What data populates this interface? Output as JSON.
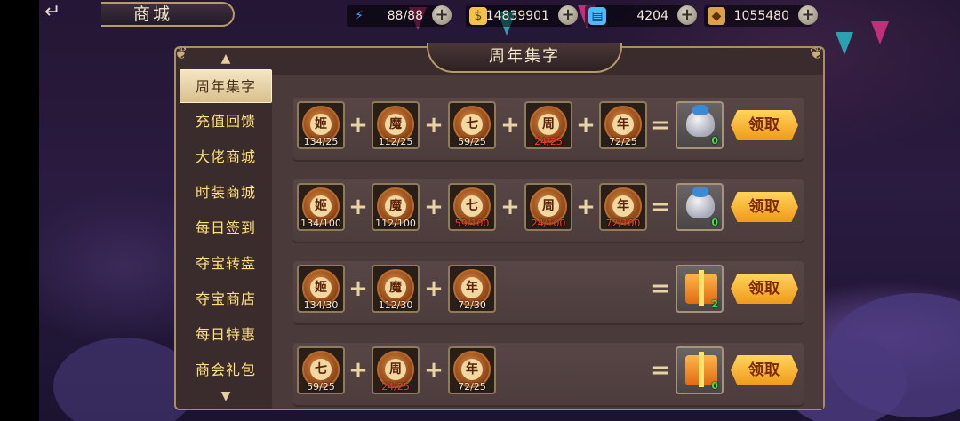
{
  "header": {
    "back_symbol": "↵",
    "title": "商城"
  },
  "resources": [
    {
      "icon": "energy-icon",
      "value": "88/88",
      "color": "#3aa2ff"
    },
    {
      "icon": "gold-coin-icon",
      "value": "14839901",
      "color": "#f2c24a"
    },
    {
      "icon": "ticket-icon",
      "value": "4204",
      "color": "#4fb8ff"
    },
    {
      "icon": "gem-icon",
      "value": "1055480",
      "color": "#d9a24a"
    }
  ],
  "panel": {
    "title": "周年集字"
  },
  "sidebar": {
    "items": [
      {
        "label": "周年集字",
        "active": true
      },
      {
        "label": "充值回馈"
      },
      {
        "label": "大佬商城"
      },
      {
        "label": "时装商城"
      },
      {
        "label": "每日签到"
      },
      {
        "label": "夺宝转盘"
      },
      {
        "label": "夺宝商店"
      },
      {
        "label": "每日特惠"
      },
      {
        "label": "商会礼包"
      }
    ]
  },
  "rows": [
    {
      "items": [
        {
          "char": "姬",
          "count": "134/25",
          "insufficient": false
        },
        {
          "char": "魔",
          "count": "112/25",
          "insufficient": false
        },
        {
          "char": "七",
          "count": "59/25",
          "insufficient": false
        },
        {
          "char": "周",
          "count": "24/25",
          "insufficient": true
        },
        {
          "char": "年",
          "count": "72/25",
          "insufficient": false
        }
      ],
      "reward": {
        "type": "bag",
        "count": "0"
      },
      "button": "领取"
    },
    {
      "items": [
        {
          "char": "姬",
          "count": "134/100",
          "insufficient": false
        },
        {
          "char": "魔",
          "count": "112/100",
          "insufficient": false
        },
        {
          "char": "七",
          "count": "59/100",
          "insufficient": true
        },
        {
          "char": "周",
          "count": "24/100",
          "insufficient": true
        },
        {
          "char": "年",
          "count": "72/100",
          "insufficient": true
        }
      ],
      "reward": {
        "type": "bag",
        "count": "0"
      },
      "button": "领取"
    },
    {
      "items": [
        {
          "char": "姬",
          "count": "134/30",
          "insufficient": false
        },
        {
          "char": "魔",
          "count": "112/30",
          "insufficient": false
        },
        {
          "char": "年",
          "count": "72/30",
          "insufficient": false
        }
      ],
      "reward": {
        "type": "gift",
        "count": "2"
      },
      "button": "领取"
    },
    {
      "items": [
        {
          "char": "七",
          "count": "59/25",
          "insufficient": false
        },
        {
          "char": "周",
          "count": "24/25",
          "insufficient": true
        },
        {
          "char": "年",
          "count": "72/25",
          "insufficient": false
        }
      ],
      "reward": {
        "type": "gift",
        "count": "0"
      },
      "button": "领取"
    }
  ]
}
